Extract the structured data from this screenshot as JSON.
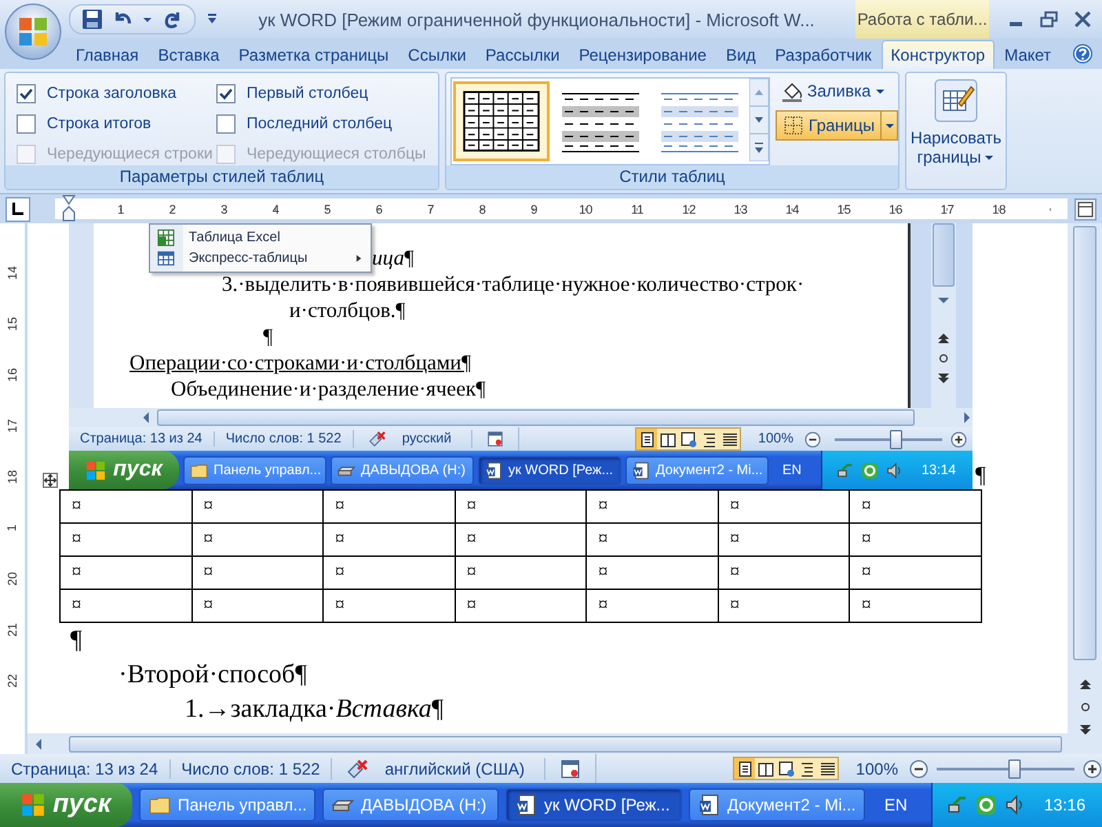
{
  "title_bar": {
    "title": "ук WORD [Режим ограниченной функциональности] - Microsoft W...",
    "context_tab": "Работа с табли..."
  },
  "ribbon_tabs": [
    {
      "label": "Главная",
      "selected": false
    },
    {
      "label": "Вставка",
      "selected": false
    },
    {
      "label": "Разметка страницы",
      "selected": false
    },
    {
      "label": "Ссылки",
      "selected": false
    },
    {
      "label": "Рассылки",
      "selected": false
    },
    {
      "label": "Рецензирование",
      "selected": false
    },
    {
      "label": "Вид",
      "selected": false
    },
    {
      "label": "Разработчик",
      "selected": false
    },
    {
      "label": "Конструктор",
      "selected": true
    },
    {
      "label": "Макет",
      "selected": false
    }
  ],
  "style_options": {
    "title": "Параметры стилей таблиц",
    "options": [
      {
        "label": "Строка заголовка",
        "checked": true,
        "disabled": false
      },
      {
        "label": "Первый столбец",
        "checked": true,
        "disabled": false
      },
      {
        "label": "Строка итогов",
        "checked": false,
        "disabled": false
      },
      {
        "label": "Последний столбец",
        "checked": false,
        "disabled": false
      },
      {
        "label": "Чередующиеся строки",
        "checked": false,
        "disabled": true
      },
      {
        "label": "Чередующиеся столбцы",
        "checked": false,
        "disabled": true
      }
    ]
  },
  "table_styles": {
    "title": "Стили таблиц",
    "styles": [
      {
        "kind": "grid",
        "selected": true
      },
      {
        "kind": "gray-bands",
        "selected": false
      },
      {
        "kind": "blue-bands",
        "selected": false
      }
    ],
    "shading": "Заливка",
    "borders": {
      "label": "Границы",
      "active": true
    }
  },
  "draw_borders": "Нарисовать границы",
  "ruler": {
    "h_numbers": [
      "1",
      "2",
      "3",
      "4",
      "5",
      "6",
      "7",
      "8",
      "9",
      "10",
      "11",
      "12",
      "13",
      "14",
      "15",
      "16",
      "17",
      "18"
    ],
    "v_numbers": [
      "14",
      "15",
      "16",
      "17",
      "18",
      "1",
      "20",
      "21",
      "22"
    ]
  },
  "embedded_screenshot": {
    "menu": [
      {
        "label": "Таблица Excel",
        "kind": "excel",
        "submenu": false
      },
      {
        "label": "Экспресс-таблицы",
        "kind": "table",
        "submenu": true
      }
    ],
    "lines": [
      {
        "kind": "caption",
        "text": "*ица*¶"
      },
      {
        "kind": "list-item",
        "text": "3.·выделить·в·появившейся·таблице·нужное·количество·строк·"
      },
      {
        "kind": "continuation",
        "text": "и·столбцов.¶"
      },
      {
        "kind": "blank",
        "text": "¶"
      },
      {
        "kind": "heading",
        "text": "Операции·со·строками·и·столбцами¶"
      },
      {
        "kind": "subheading",
        "text": "Объединение·и·разделение·ячеек¶"
      }
    ],
    "status_bar": {
      "page": "Страница: 13 из 24",
      "words": "Число слов: 1 522",
      "language": "русский",
      "views": [
        {
          "kind": "print",
          "selected": true
        },
        {
          "kind": "reading",
          "selected": false
        },
        {
          "kind": "web",
          "selected": false
        },
        {
          "kind": "outline",
          "selected": false
        },
        {
          "kind": "draft",
          "selected": false
        }
      ],
      "zoom": "100%",
      "zoom_slider": {
        "level": 0.55
      }
    },
    "taskbar": {
      "start": "пуск",
      "tasks": [
        {
          "label": "Панель управл...",
          "kind": "folder",
          "selected": false
        },
        {
          "label": "ДАВЫДОВА (H:)",
          "kind": "drive",
          "selected": false
        },
        {
          "label": "ук WORD [Реж...",
          "kind": "word",
          "selected": true
        },
        {
          "label": "Документ2 - Mi...",
          "kind": "word",
          "selected": false
        }
      ],
      "language": "EN",
      "clock": "13:14"
    }
  },
  "end_mark": "¶",
  "table": {
    "rows": [
      [
        "¤",
        "¤",
        "¤",
        "¤",
        "¤",
        "¤",
        "¤"
      ],
      [
        "¤",
        "¤",
        "¤",
        "¤",
        "¤",
        "¤",
        "¤"
      ],
      [
        "¤",
        "¤",
        "¤",
        "¤",
        "¤",
        "¤",
        "¤"
      ],
      [
        "¤",
        "¤",
        "¤",
        "¤",
        "¤",
        "¤",
        "¤"
      ]
    ]
  },
  "lines": [
    {
      "kind": "mark",
      "text": "¶"
    },
    {
      "kind": "item",
      "text": "·Второй·способ¶"
    },
    {
      "kind": "step",
      "text": "1.→закладка·*Вставка*¶"
    }
  ],
  "status_bar": {
    "page": "Страница: 13 из 24",
    "words": "Число слов: 1 522",
    "language": "английский (США)",
    "views": [
      {
        "kind": "print",
        "selected": true
      },
      {
        "kind": "reading",
        "selected": false
      },
      {
        "kind": "web",
        "selected": false
      },
      {
        "kind": "outline",
        "selected": false
      },
      {
        "kind": "draft",
        "selected": false
      }
    ],
    "zoom": "100%",
    "zoom_slider": {
      "level": 0.55
    }
  },
  "taskbar": {
    "start": "пуск",
    "tasks": [
      {
        "label": "Панель управл...",
        "kind": "folder",
        "selected": false
      },
      {
        "label": "ДАВЫДОВА (H:)",
        "kind": "drive",
        "selected": false
      },
      {
        "label": "ук WORD [Реж...",
        "kind": "word",
        "selected": true
      },
      {
        "label": "Документ2 - Mi...",
        "kind": "word",
        "selected": false
      }
    ],
    "language": "EN",
    "clock": "13:16"
  }
}
